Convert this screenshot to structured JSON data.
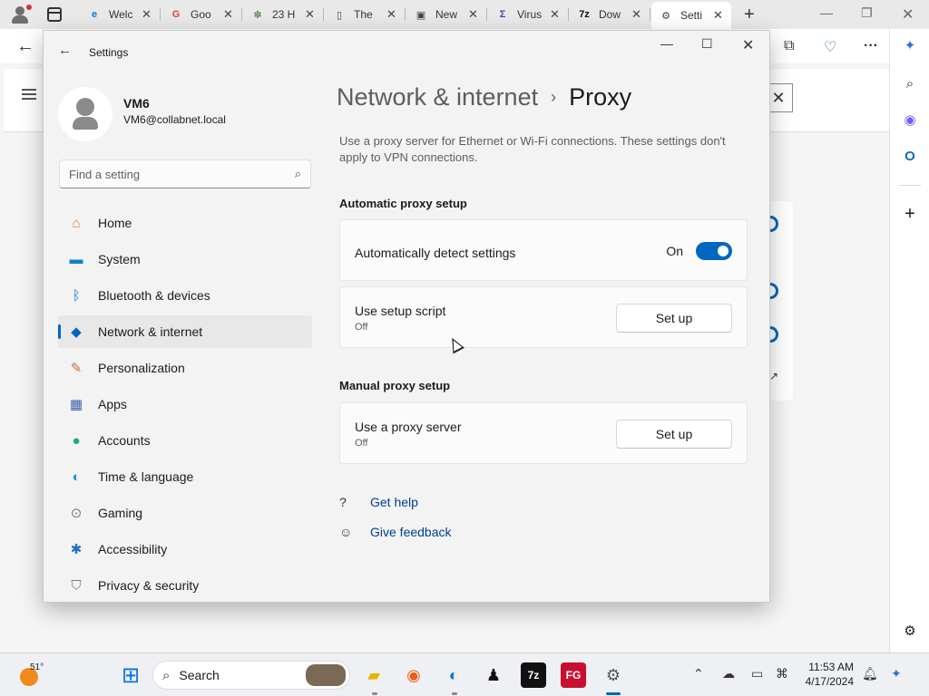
{
  "browser": {
    "tabs": [
      {
        "title": "Welc",
        "icon": "edge-icon",
        "favicon_text": "e",
        "color": "#0f7bd9"
      },
      {
        "title": "Goo",
        "icon": "chrome-icon",
        "favicon_text": "G",
        "color": "#db4437"
      },
      {
        "title": "23 H",
        "icon": "gear-flower-icon",
        "favicon_text": "✽",
        "color": "#6b8e5a"
      },
      {
        "title": "The",
        "icon": "document-icon",
        "favicon_text": "▯",
        "color": "#444444"
      },
      {
        "title": "New",
        "icon": "newtab-icon",
        "favicon_text": "▣",
        "color": "#444444"
      },
      {
        "title": "Virus",
        "icon": "virustotal-icon",
        "favicon_text": "Σ",
        "color": "#3949ab"
      },
      {
        "title": "Dow",
        "icon": "7zip-icon",
        "favicon_text": "7z",
        "color": "#111111"
      },
      {
        "title": "Setti",
        "icon": "settings-icon",
        "favicon_text": "⚙",
        "color": "#444444"
      }
    ],
    "new_tab": "+"
  },
  "settings": {
    "window_title": "Settings",
    "user": {
      "name": "VM6",
      "email": "VM6@collabnet.local"
    },
    "search": {
      "placeholder": "Find a setting"
    },
    "nav": [
      {
        "label": "Home",
        "icon": "home-icon",
        "glyph": "⌂",
        "color": "#e07b39"
      },
      {
        "label": "System",
        "icon": "system-icon",
        "glyph": "▬",
        "color": "#0a84c6"
      },
      {
        "label": "Bluetooth & devices",
        "icon": "bluetooth-icon",
        "glyph": "ᛒ",
        "color": "#0a84c6"
      },
      {
        "label": "Network & internet",
        "icon": "wifi-icon",
        "glyph": "◆",
        "color": "#0067c0"
      },
      {
        "label": "Personalization",
        "icon": "brush-icon",
        "glyph": "✎",
        "color": "#c0703a"
      },
      {
        "label": "Apps",
        "icon": "apps-icon",
        "glyph": "▦",
        "color": "#3a5fa8"
      },
      {
        "label": "Accounts",
        "icon": "accounts-icon",
        "glyph": "●",
        "color": "#1ea68a"
      },
      {
        "label": "Time & language",
        "icon": "globe-icon",
        "glyph": "◐",
        "color": "#2a8fd0"
      },
      {
        "label": "Gaming",
        "icon": "gamepad-icon",
        "glyph": "⊙",
        "color": "#7a7a7a"
      },
      {
        "label": "Accessibility",
        "icon": "accessibility-icon",
        "glyph": "✱",
        "color": "#1e6fc4"
      },
      {
        "label": "Privacy & security",
        "icon": "shield-icon",
        "glyph": "⛉",
        "color": "#7a7a7a"
      }
    ],
    "selected_nav_index": 3,
    "breadcrumb": {
      "parent": "Network & internet",
      "separator": "›",
      "current": "Proxy"
    },
    "description": "Use a proxy server for Ethernet or Wi-Fi connections. These settings don't apply to VPN connections.",
    "automatic": {
      "heading": "Automatic proxy setup",
      "detect": {
        "label": "Automatically detect settings",
        "state": "On",
        "enabled": true
      },
      "script": {
        "label": "Use setup script",
        "status": "Off",
        "button": "Set up"
      }
    },
    "manual": {
      "heading": "Manual proxy setup",
      "proxy": {
        "label": "Use a proxy server",
        "status": "Off",
        "button": "Set up"
      }
    },
    "links": {
      "help": "Get help",
      "feedback": "Give feedback"
    },
    "accent_color": "#0067c0"
  },
  "taskbar": {
    "weather_temp": "51°",
    "search_text": "Search",
    "time": "11:53 AM",
    "date": "4/17/2024"
  }
}
